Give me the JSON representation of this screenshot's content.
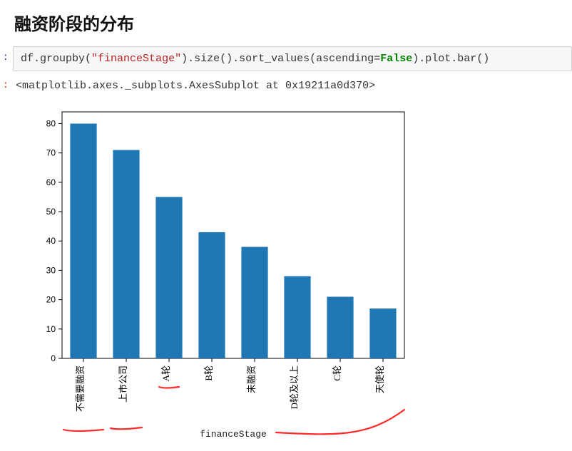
{
  "heading": "融资阶段的分布",
  "code_tokens": {
    "t1": "df.",
    "t2": "groupby",
    "t3": "(",
    "t4": "\"financeStage\"",
    "t5": ").",
    "t6": "size",
    "t7": "().",
    "t8": "sort_values",
    "t9": "(",
    "t10": "ascending",
    "t11": "=",
    "t12": "False",
    "t13": ").",
    "t14": "plot",
    "t15": ".",
    "t16": "bar",
    "t17": "()"
  },
  "prompt_symbol": ":",
  "output_text": "<matplotlib.axes._subplots.AxesSubplot at 0x19211a0d370>",
  "chart_data": {
    "type": "bar",
    "title": "",
    "xlabel": "financeStage",
    "ylabel": "",
    "categories": [
      "不需要融资",
      "上市公司",
      "A轮",
      "B轮",
      "未融资",
      "D轮及以上",
      "C轮",
      "天使轮"
    ],
    "values": [
      80,
      71,
      55,
      43,
      38,
      28,
      21,
      17
    ],
    "yticks": [
      0,
      10,
      20,
      30,
      40,
      50,
      60,
      70,
      80
    ],
    "ylim": [
      0,
      84
    ]
  }
}
